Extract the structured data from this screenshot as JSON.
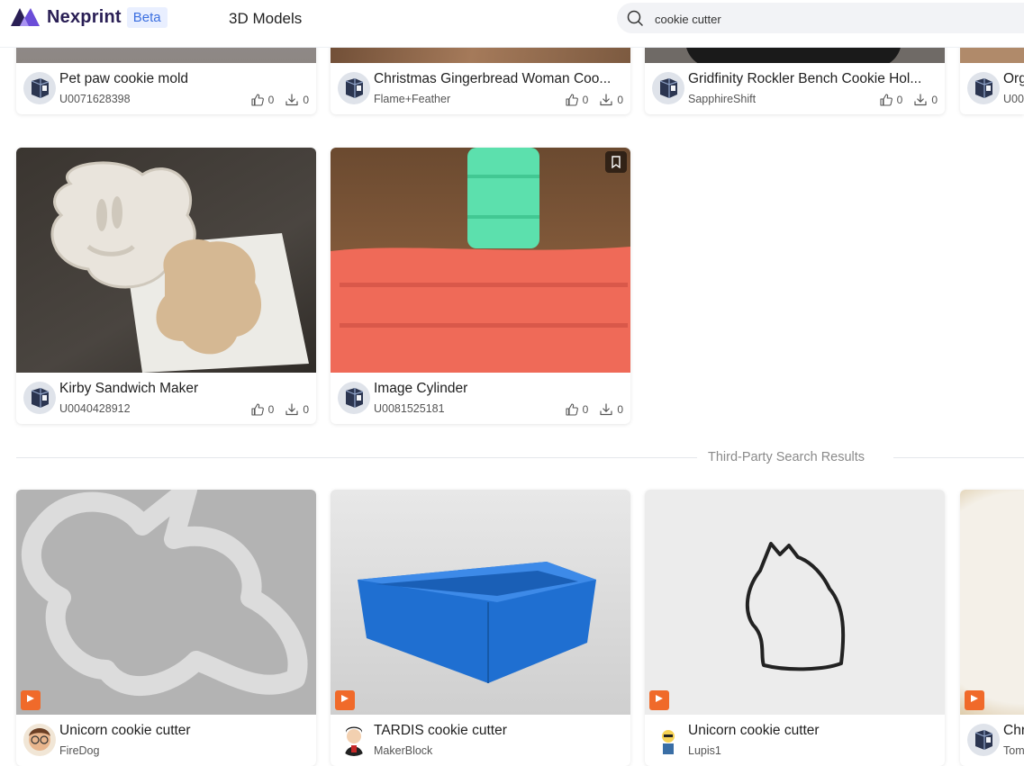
{
  "header": {
    "brand": "Nexprint",
    "beta_label": "Beta",
    "nav_models": "3D Models",
    "search": {
      "value": "cookie cutter",
      "placeholder": ""
    }
  },
  "cards_top": [
    {
      "title": "Pet paw cookie mold",
      "author": "U0071628398",
      "likes": "0",
      "downloads": "0"
    },
    {
      "title": "Christmas Gingerbread Woman Coo...",
      "author": "Flame+Feather",
      "likes": "0",
      "downloads": "0"
    },
    {
      "title": "Gridfinity Rockler Bench Cookie Hol...",
      "author": "SapphireShift",
      "likes": "0",
      "downloads": "0"
    },
    {
      "title": "Org",
      "author": "U00"
    }
  ],
  "cards_mid": [
    {
      "title": "Kirby Sandwich Maker",
      "author": "U0040428912",
      "likes": "0",
      "downloads": "0"
    },
    {
      "title": "Image Cylinder",
      "author": "U0081525181",
      "likes": "0",
      "downloads": "0"
    }
  ],
  "section_label": "Third-Party Search Results",
  "cards_third_party": [
    {
      "title": "Unicorn cookie cutter",
      "author": "FireDog"
    },
    {
      "title": "TARDIS cookie cutter",
      "author": "MakerBlock"
    },
    {
      "title": "Unicorn cookie cutter",
      "author": "Lupis1"
    },
    {
      "title": "Chr",
      "author": "Tom"
    }
  ],
  "icons": {
    "search": "search-icon",
    "like": "thumbs-up-icon",
    "download": "download-icon",
    "bookmark": "bookmark-icon",
    "printables": "printables-badge-icon"
  },
  "colors": {
    "brand": "#2a1f55",
    "accent": "#3b6fe0",
    "badge": "#f06a2a"
  }
}
